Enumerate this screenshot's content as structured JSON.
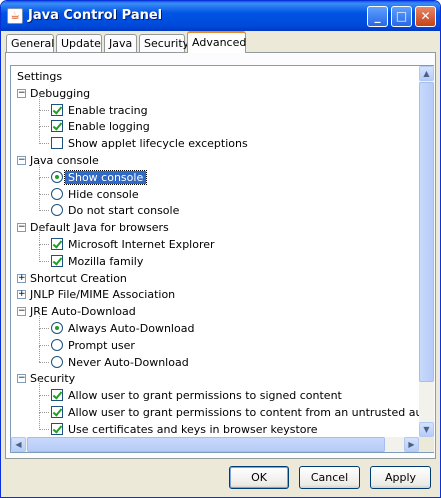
{
  "window": {
    "title": "Java Control Panel"
  },
  "tabs": [
    "General",
    "Update",
    "Java",
    "Security",
    "Advanced"
  ],
  "active_tab": "Advanced",
  "tree": {
    "root": "Settings",
    "items": [
      {
        "label": "Debugging",
        "kind": "group",
        "state": "expanded"
      },
      {
        "label": "Enable tracing",
        "kind": "checkbox",
        "checked": true
      },
      {
        "label": "Enable logging",
        "kind": "checkbox",
        "checked": true
      },
      {
        "label": "Show applet lifecycle exceptions",
        "kind": "checkbox",
        "checked": false
      },
      {
        "label": "Java console",
        "kind": "group",
        "state": "expanded"
      },
      {
        "label": "Show console",
        "kind": "radio",
        "checked": true,
        "selected": true
      },
      {
        "label": "Hide console",
        "kind": "radio",
        "checked": false
      },
      {
        "label": "Do not start console",
        "kind": "radio",
        "checked": false
      },
      {
        "label": "Default Java for browsers",
        "kind": "group",
        "state": "expanded"
      },
      {
        "label": "Microsoft Internet Explorer",
        "kind": "checkbox",
        "checked": true
      },
      {
        "label": "Mozilla family",
        "kind": "checkbox",
        "checked": true
      },
      {
        "label": "Shortcut Creation",
        "kind": "group",
        "state": "collapsed"
      },
      {
        "label": "JNLP File/MIME Association",
        "kind": "group",
        "state": "collapsed"
      },
      {
        "label": "JRE Auto-Download",
        "kind": "group",
        "state": "expanded"
      },
      {
        "label": "Always Auto-Download",
        "kind": "radio",
        "checked": true
      },
      {
        "label": "Prompt user",
        "kind": "radio",
        "checked": false
      },
      {
        "label": "Never Auto-Download",
        "kind": "radio",
        "checked": false
      },
      {
        "label": "Security",
        "kind": "group",
        "state": "expanded"
      },
      {
        "label": "Allow user to grant permissions to signed content",
        "kind": "checkbox",
        "checked": true
      },
      {
        "label": "Allow user to grant permissions to content from an untrusted authority",
        "kind": "checkbox",
        "checked": true
      },
      {
        "label": "Use certificates and keys in browser keystore",
        "kind": "checkbox",
        "checked": true
      }
    ]
  },
  "buttons": {
    "ok": "OK",
    "cancel": "Cancel",
    "apply": "Apply"
  },
  "colors": {
    "titlebar": "#0055e5",
    "selection": "#316ac5",
    "check": "#21a121",
    "tab_accent": "#e68b2c"
  }
}
